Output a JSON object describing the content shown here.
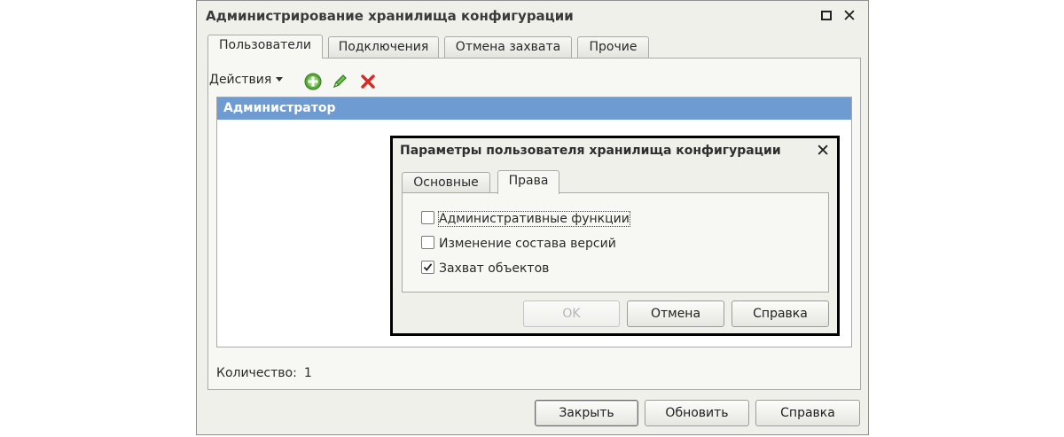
{
  "window": {
    "title": "Администрирование хранилища конфигурации",
    "tabs": [
      {
        "label": "Пользователи",
        "active": true
      },
      {
        "label": "Подключения",
        "active": false
      },
      {
        "label": "Отмена захвата",
        "active": false
      },
      {
        "label": "Прочие",
        "active": false
      }
    ],
    "toolbar": {
      "actions_label": "Действия",
      "icons": [
        "add-icon",
        "edit-icon",
        "delete-icon"
      ]
    },
    "users": [
      {
        "name": "Администратор",
        "selected": true
      }
    ],
    "count_label": "Количество:",
    "count_value": "1",
    "buttons": {
      "close": "Закрыть",
      "refresh": "Обновить",
      "help": "Справка"
    }
  },
  "dialog": {
    "title": "Параметры пользователя хранилища конфигурации",
    "tabs": [
      {
        "label": "Основные",
        "active": false
      },
      {
        "label": "Права",
        "active": true
      }
    ],
    "rights": [
      {
        "label": "Административные функции",
        "checked": false
      },
      {
        "label": "Изменение состава версий",
        "checked": false
      },
      {
        "label": "Захват объектов",
        "checked": true
      }
    ],
    "buttons": {
      "ok": "OK",
      "cancel": "Отмена",
      "help": "Справка"
    }
  },
  "colors": {
    "selection": "#6f9bd3",
    "add": "#5aa83c",
    "edit": "#3d9a2b",
    "delete": "#d62b22"
  }
}
